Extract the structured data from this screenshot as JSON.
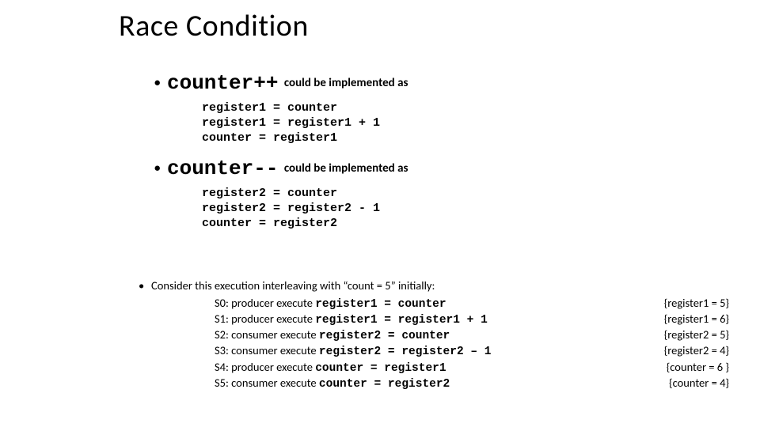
{
  "title": "Race Condition",
  "bullets": [
    {
      "code": "counter++",
      "suffix": " could be implemented as",
      "block": "register1 = counter\nregister1 = register1 + 1\ncounter = register1"
    },
    {
      "code": "counter--",
      "suffix": " could be implemented as",
      "block": "register2 = counter\nregister2 = register2 - 1\ncounter = register2"
    }
  ],
  "interleaving": {
    "intro": "Consider this execution interleaving with “count = 5” initially:",
    "steps": [
      {
        "prefix": "S0: producer execute ",
        "code": "register1 = counter",
        "result": "{register1 = 5}"
      },
      {
        "prefix": "S1: producer execute ",
        "code": "register1 = register1 + 1",
        "result": "{register1 = 6}"
      },
      {
        "prefix": "S2: consumer execute ",
        "code": "register2 = counter",
        "result": "{register2 = 5}"
      },
      {
        "prefix": "S3: consumer execute ",
        "code": "register2 = register2 – 1",
        "result": "{register2 = 4}"
      },
      {
        "prefix": "S4: producer execute ",
        "code": "counter = register1",
        "result": "{counter = 6 }"
      },
      {
        "prefix": "S5: consumer execute ",
        "code": "counter = register2",
        "result": "{counter = 4}"
      }
    ]
  }
}
